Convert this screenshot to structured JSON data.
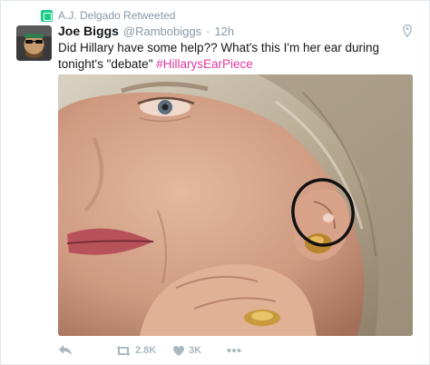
{
  "retweet_context": {
    "text": "A.J. Delgado Retweeted",
    "icon": "retweet-icon"
  },
  "author": {
    "display_name": "Joe Biggs",
    "handle": "@Rambobiggs",
    "separator": "·",
    "time": "12h"
  },
  "tweet": {
    "text_before_hashtag": "Did Hillary have some help?? What's this I'm her ear during tonight's \"debate\" ",
    "hashtag": "#HillarysEarPiece"
  },
  "actions": {
    "reply_icon": "reply-icon",
    "retweet_icon": "retweet-icon",
    "retweet_count": "2.8K",
    "like_icon": "heart-icon",
    "like_count": "3K",
    "more_icon": "more-icon"
  },
  "colors": {
    "hashtag": "#e0399b",
    "retweet_badge": "#19cf86",
    "muted_text": "#8899a6",
    "action_icons": "#aab8c2"
  }
}
